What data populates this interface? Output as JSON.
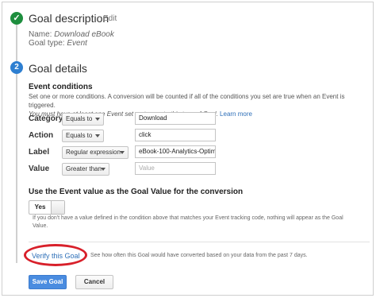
{
  "goal_description": {
    "step_icon": "check-icon",
    "title": "Goal description",
    "edit_label": "Edit",
    "name_label": "Name:",
    "name_value": "Download eBook",
    "type_label": "Goal type:",
    "type_value": "Event"
  },
  "goal_details": {
    "step_number": "2",
    "title": "Goal details",
    "event_conditions": {
      "title": "Event conditions",
      "desc_line1": "Set one or more conditions. A conversion will be counted if all of the conditions you set are true when an Event is triggered.",
      "desc_line2": "You must have at least one Event set up to create this type of Goal.",
      "learn_more": "Learn more",
      "rows": [
        {
          "label": "Category",
          "operator": "Equals to",
          "value": "Download",
          "placeholder": ""
        },
        {
          "label": "Action",
          "operator": "Equals to",
          "value": "click",
          "placeholder": ""
        },
        {
          "label": "Label",
          "operator": "Regular expression",
          "value": "eBook-100-Analytics-Optim",
          "placeholder": ""
        },
        {
          "label": "Value",
          "operator": "Greater than",
          "value": "",
          "placeholder": "Value"
        }
      ]
    },
    "use_event_value": {
      "title": "Use the Event value as the Goal Value for the conversion",
      "toggle_label": "Yes",
      "note_line1": "If you don't have a value defined in the condition above that matches your Event tracking code, nothing will appear as the Goal",
      "note_line2": "Value."
    }
  },
  "verify": {
    "link_label": "Verify this Goal",
    "description": "See how often this Goal would have converted based on your data from the past 7 days."
  },
  "actions": {
    "save_label": "Save Goal",
    "cancel_label": "Cancel"
  },
  "colors": {
    "step_done": "#1e8e3e",
    "step_active": "#2e7fd1",
    "link": "#2e6fb8",
    "primary_button": "#4a8ce0",
    "highlight_ellipse": "#d8202a"
  }
}
